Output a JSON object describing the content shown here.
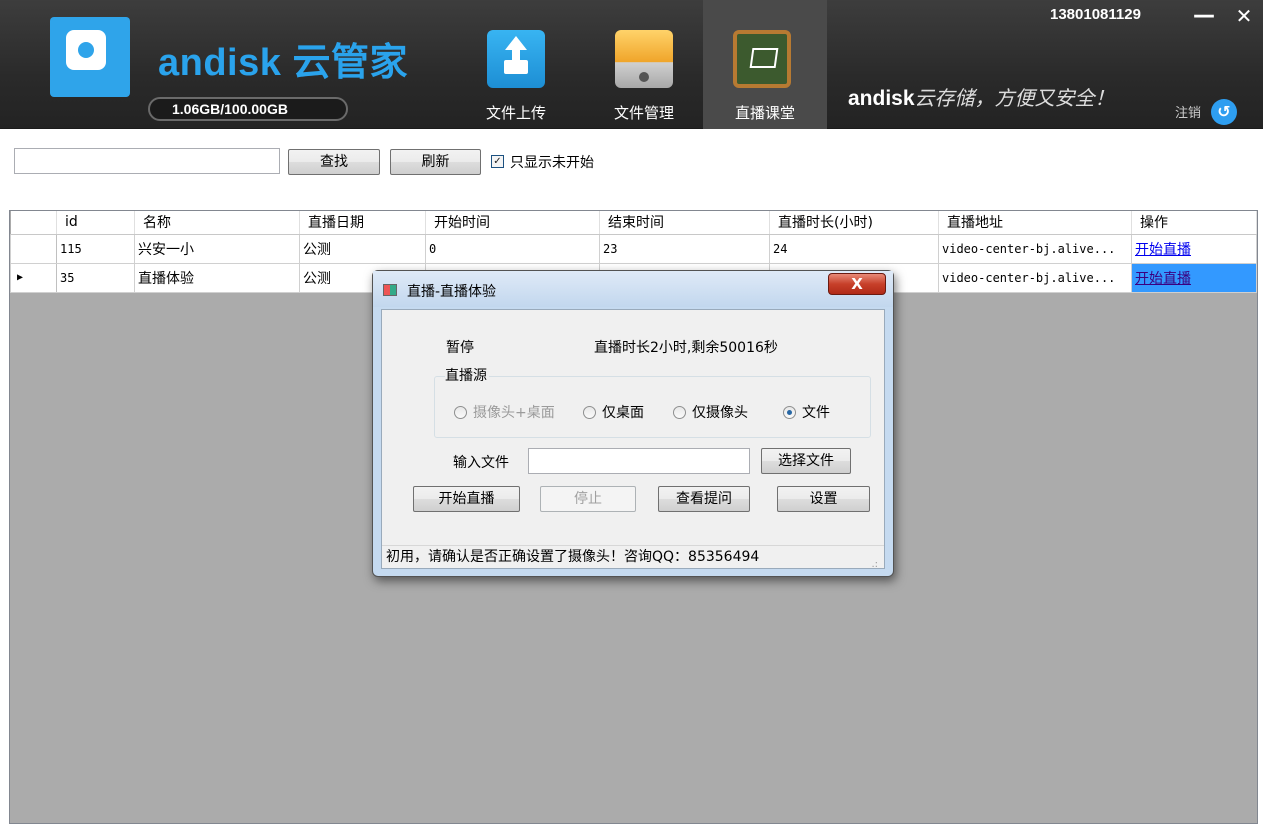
{
  "header": {
    "brand": "andisk 云管家",
    "storage": "1.06GB/100.00GB",
    "phone": "13801081129",
    "slogan_brand": "andisk",
    "slogan_text": "云存储，方便又安全！",
    "logout": "注销",
    "nav": [
      {
        "label": "文件上传",
        "icon": "upload-icon"
      },
      {
        "label": "文件管理",
        "icon": "file-cabinet-icon"
      },
      {
        "label": "直播课堂",
        "icon": "blackboard-icon"
      }
    ],
    "minimize": "—",
    "close": "✕"
  },
  "toolbar": {
    "search_value": "",
    "search_label": "查找",
    "refresh_label": "刷新",
    "filter_checked": true,
    "filter_label": "只显示未开始"
  },
  "table": {
    "columns": [
      "id",
      "名称",
      "直播日期",
      "开始时间",
      "结束时间",
      "直播时长(小时)",
      "直播地址",
      "操作"
    ],
    "rows": [
      {
        "id": "115",
        "name": "兴安一小",
        "date": "公测",
        "start": "0",
        "end": "23",
        "duration": "24",
        "address": "video-center-bj.alive...",
        "action": "开始直播"
      },
      {
        "id": "35",
        "name": "直播体验",
        "date": "公测",
        "start": "",
        "end": "",
        "duration": "",
        "address": "video-center-bj.alive...",
        "action": "开始直播"
      }
    ]
  },
  "dialog": {
    "title": "直播-直播体验",
    "close": "X",
    "status": "暂停",
    "duration": "直播时长2小时,剩余50016秒",
    "source_legend": "直播源",
    "sources": [
      {
        "label": "摄像头+桌面",
        "selected": false,
        "disabled": true
      },
      {
        "label": "仅桌面",
        "selected": false,
        "disabled": false
      },
      {
        "label": "仅摄像头",
        "selected": false,
        "disabled": false
      },
      {
        "label": "文件",
        "selected": true,
        "disabled": false
      }
    ],
    "file_label": "输入文件",
    "file_value": "",
    "choose_file": "选择文件",
    "start": "开始直播",
    "stop": "停止",
    "questions": "查看提问",
    "settings": "设置",
    "statusbar": "初用，请确认是否正确设置了摄像头！咨询QQ：85356494"
  }
}
